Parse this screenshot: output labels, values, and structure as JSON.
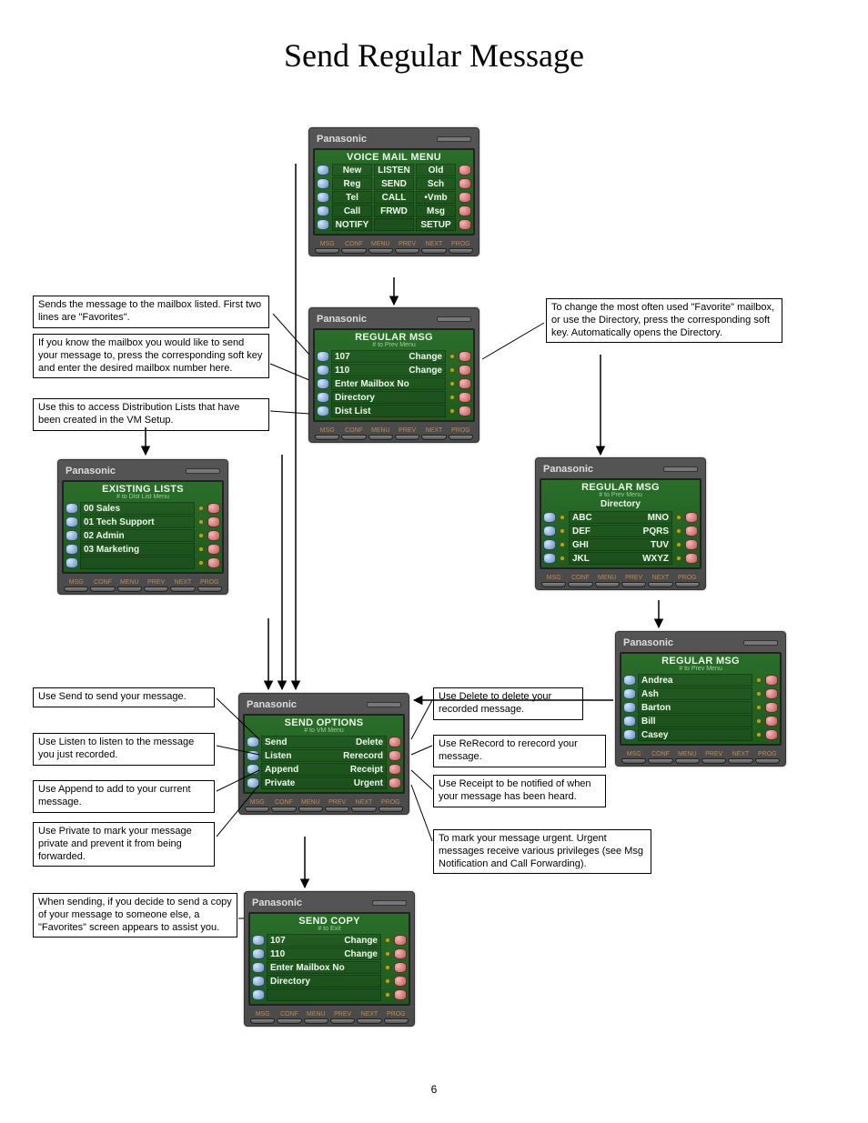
{
  "page": {
    "title": "Send Regular Message",
    "number": "6"
  },
  "notes": {
    "sends": "Sends the message to the mailbox listed. First two lines are \"Favorites\".",
    "know_mailbox": "If you know the mailbox you would like to send your message to, press the corresponding soft key and enter the desired mailbox number here.",
    "dist_lists": "Use this to access Distribution Lists that have been created in the VM Setup.",
    "change_fav": "To change the most often used \"Favorite\" mailbox, or use the Directory, press the corresponding soft key.  Automatically opens the Directory.",
    "use_send": "Use Send  to send your message.",
    "use_listen": "Use Listen to listen to the message you just recorded.",
    "use_append": "Use Append to add to your current message.",
    "use_private": "Use Private to mark your message private and prevent it from being forwarded.",
    "use_delete": "Use Delete to delete your recorded message.",
    "use_rerecord": "Use ReRecord to rerecord your message.",
    "use_receipt": "Use Receipt to be notified of when your message has been heard.",
    "use_urgent": "To mark your message urgent.  Urgent messages receive various privileges (see Msg Notification and Call Forwarding).",
    "send_copy": "When sending, if you decide to send a copy of your message to someone else, a \"Favorites\" screen appears to assist you."
  },
  "brand": "Panasonic",
  "hdr_small": "",
  "vm_menu": {
    "title": "VOICE MAIL MENU",
    "rows": [
      [
        "New",
        "LISTEN",
        "Old"
      ],
      [
        "Reg",
        "SEND",
        "Sch"
      ],
      [
        "Tel",
        "CALL",
        "•Vmb"
      ],
      [
        "Call",
        "FRWD",
        "Msg"
      ],
      [
        "NOTIFY",
        "",
        "SETUP"
      ]
    ]
  },
  "reg_msg": {
    "title": "REGULAR MSG",
    "sub": "# to Prev Menu",
    "lines": {
      "l1_left": "107",
      "l1_right": "Change",
      "l2_left": "110",
      "l2_right": "Change",
      "l3": "Enter Mailbox No",
      "l4": "Directory",
      "l5": "Dist List"
    }
  },
  "existing_lists": {
    "title": "EXISTING LISTS",
    "sub": "# to Dist List Menu",
    "items": [
      "00 Sales",
      "01 Tech Support",
      "02 Admin",
      "03 Marketing",
      ""
    ]
  },
  "dir_keypad": {
    "title": "REGULAR MSG",
    "sub2": "# to Prev Menu",
    "dir": "Directory",
    "rows": [
      [
        "ABC",
        "MNO"
      ],
      [
        "DEF",
        "PQRS"
      ],
      [
        "GHI",
        "TUV"
      ],
      [
        "JKL",
        "WXYZ"
      ]
    ]
  },
  "dir_names": {
    "title": "REGULAR MSG",
    "sub2": "# to Prev Menu",
    "items": [
      "Andrea",
      "Ash",
      "Barton",
      "Bill",
      "Casey"
    ]
  },
  "send_options": {
    "title": "SEND OPTIONS",
    "sub": "# to VM Menu",
    "rows": [
      [
        "Send",
        "Delete"
      ],
      [
        "Listen",
        "Rerecord"
      ],
      [
        "Append",
        "Receipt"
      ],
      [
        "Private",
        "Urgent"
      ]
    ]
  },
  "send_copy_scr": {
    "title": "SEND COPY",
    "sub": "# to Exit",
    "lines": {
      "l1_left": "107",
      "l1_right": "Change",
      "l2_left": "110",
      "l2_right": "Change",
      "l3": "Enter Mailbox No",
      "l4": "Directory"
    }
  },
  "bottom_keys": [
    "MSG",
    "CONF",
    "MENU",
    "PREV",
    "NEXT",
    "PROG"
  ]
}
